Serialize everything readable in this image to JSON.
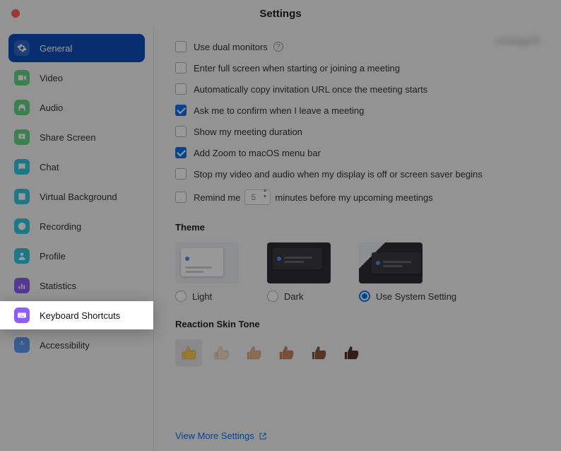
{
  "title": "Settings",
  "user_tag": "umango23",
  "sidebar": {
    "items": [
      {
        "label": "General",
        "icon": "gear",
        "color": "#FFFFFF",
        "active": true
      },
      {
        "label": "Video",
        "icon": "video",
        "color": "#65D684"
      },
      {
        "label": "Audio",
        "icon": "headphones",
        "color": "#65D684"
      },
      {
        "label": "Share Screen",
        "icon": "share",
        "color": "#65D684"
      },
      {
        "label": "Chat",
        "icon": "chat",
        "color": "#30C8DE"
      },
      {
        "label": "Virtual Background",
        "icon": "vbg",
        "color": "#30C8DE"
      },
      {
        "label": "Recording",
        "icon": "record",
        "color": "#30C8DE"
      },
      {
        "label": "Profile",
        "icon": "profile",
        "color": "#30C8DE"
      },
      {
        "label": "Statistics",
        "icon": "stats",
        "color": "#8E5CF7"
      },
      {
        "label": "Keyboard Shortcuts",
        "icon": "keyboard",
        "color": "#8E5CF7",
        "highlighted": true
      },
      {
        "label": "Accessibility",
        "icon": "accessibility",
        "color": "#5C9CF7"
      }
    ]
  },
  "options": [
    {
      "label": "Use dual monitors",
      "checked": false,
      "help": true
    },
    {
      "label": "Enter full screen when starting or joining a meeting",
      "checked": false
    },
    {
      "label": "Automatically copy invitation URL once the meeting starts",
      "checked": false
    },
    {
      "label": "Ask me to confirm when I leave a meeting",
      "checked": true
    },
    {
      "label": "Show my meeting duration",
      "checked": false
    },
    {
      "label": "Add Zoom to macOS menu bar",
      "checked": true
    },
    {
      "label": "Stop my video and audio when my display is off or screen saver begins",
      "checked": false
    }
  ],
  "remind": {
    "prefix": "Remind me",
    "value": "5",
    "suffix": "minutes before my upcoming meetings",
    "checked": false
  },
  "theme": {
    "heading": "Theme",
    "options": [
      {
        "label": "Light",
        "kind": "light",
        "selected": false
      },
      {
        "label": "Dark",
        "kind": "dark",
        "selected": false
      },
      {
        "label": "Use System Setting",
        "kind": "system",
        "selected": true
      }
    ]
  },
  "reaction": {
    "heading": "Reaction Skin Tone",
    "selected_index": 0,
    "tones": [
      "#FFCC4D",
      "#F7DEC3",
      "#E8B48A",
      "#C6865A",
      "#8B5A3C",
      "#583123"
    ]
  },
  "view_more": "View More Settings"
}
